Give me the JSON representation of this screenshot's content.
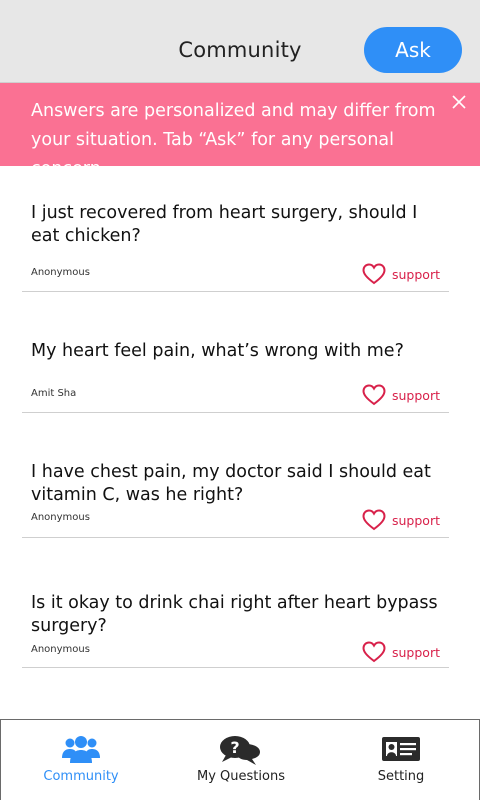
{
  "header": {
    "title": "Community",
    "ask_label": "Ask"
  },
  "banner": {
    "text": "Answers are personalized and may differ from your situation. Tab “Ask” for any personal concern.",
    "close_icon": "close-icon"
  },
  "posts": [
    {
      "question": "I just recovered from heart surgery, should I eat chicken?",
      "author": "Anonymous",
      "support_label": "support"
    },
    {
      "question": "My heart feel pain, what’s wrong with me?",
      "author": "Amit Sha",
      "support_label": "support"
    },
    {
      "question": "I have chest pain, my doctor said I should eat vitamin C, was he right?",
      "author": "Anonymous",
      "support_label": "support"
    },
    {
      "question": "Is it okay to drink chai right after heart bypass surgery?",
      "author": "Anonymous",
      "support_label": "support"
    }
  ],
  "tabs": [
    {
      "label": "Community",
      "icon": "community-icon",
      "active": true
    },
    {
      "label": "My Questions",
      "icon": "question-bubbles-icon",
      "active": false
    },
    {
      "label": "Setting",
      "icon": "id-card-icon",
      "active": false
    }
  ],
  "colors": {
    "accent": "#2f8ff7",
    "banner": "#fa7193",
    "support": "#d8214a",
    "header_bg": "#e7e7e7"
  }
}
